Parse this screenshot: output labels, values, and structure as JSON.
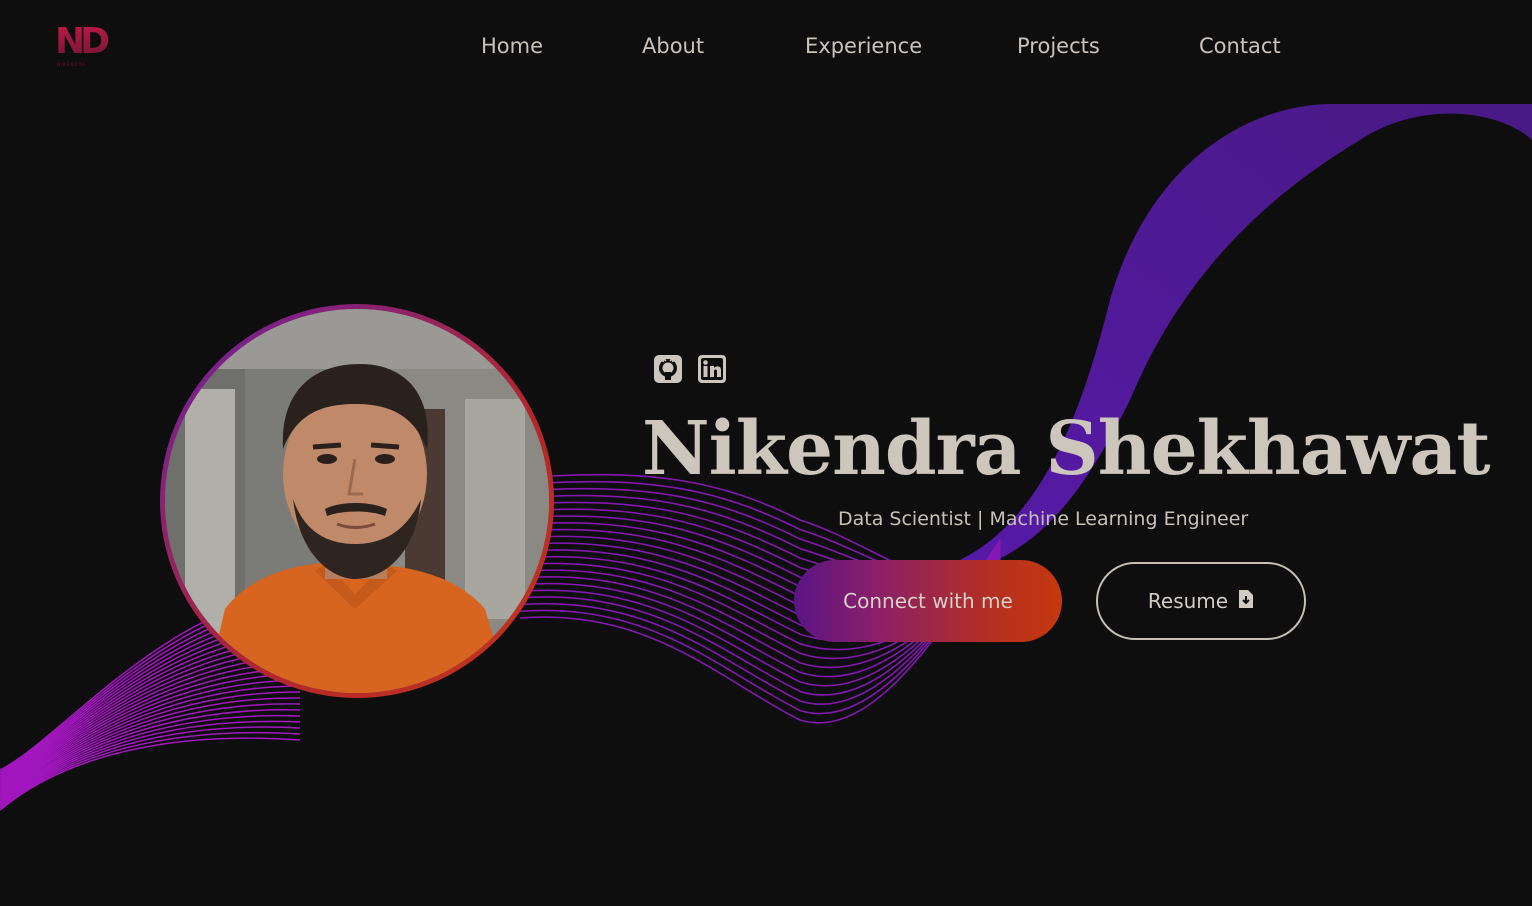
{
  "logo": {
    "text": "ND",
    "subtext": "NIKENDRA"
  },
  "nav": {
    "items": [
      {
        "label": "Home"
      },
      {
        "label": "About"
      },
      {
        "label": "Experience"
      },
      {
        "label": "Projects"
      },
      {
        "label": "Contact"
      }
    ]
  },
  "social": {
    "github_icon": "github-icon",
    "linkedin_icon": "linkedin-icon"
  },
  "hero": {
    "name": "Nikendra Shekhawat",
    "role": "Data Scientist | Machine Learning Engineer",
    "connect_label": "Connect with me",
    "resume_label": "Resume",
    "resume_icon": "file-download-icon"
  },
  "colors": {
    "background": "#0e0e0e",
    "accent_purple": "#7a1fc0",
    "accent_orange": "#c5380f",
    "text": "#cdc6bc"
  }
}
